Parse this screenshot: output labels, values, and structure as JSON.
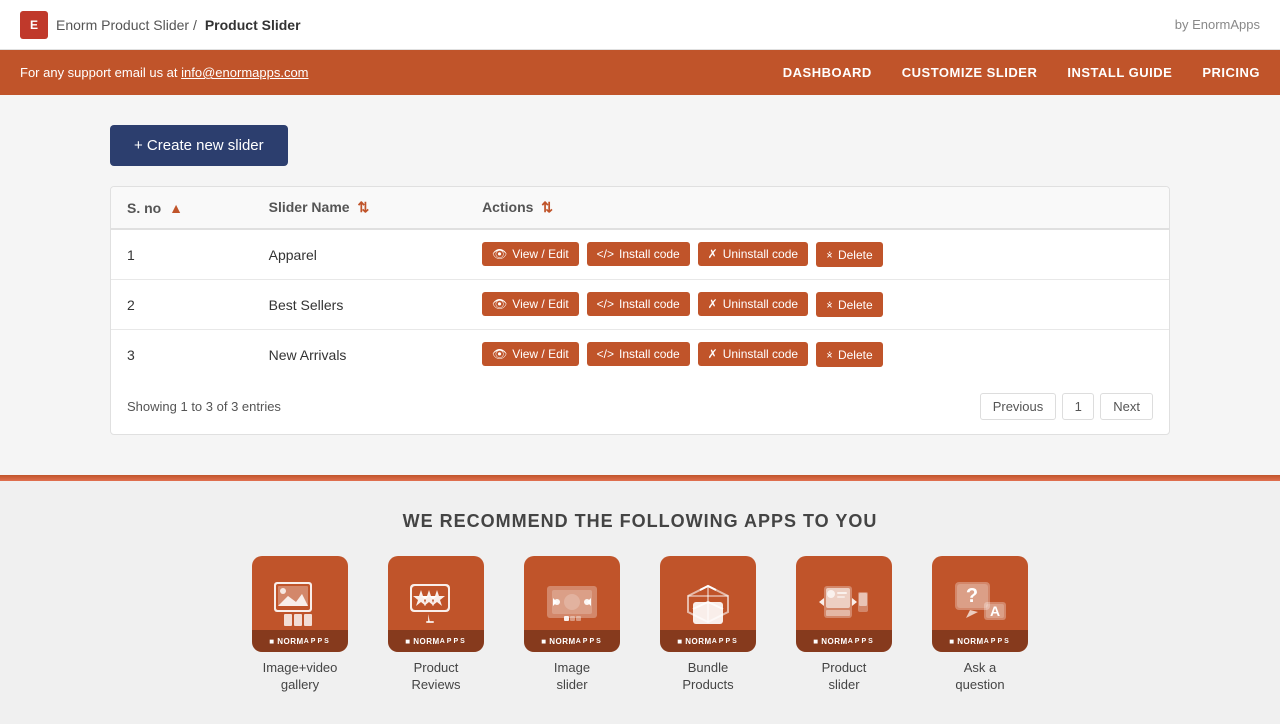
{
  "topbar": {
    "logo_text": "E",
    "breadcrumb_prefix": "Enorm Product Slider / ",
    "breadcrumb_current": "Product Slider",
    "by_label": "by EnormApps"
  },
  "navbar": {
    "support_text": "For any support email us at ",
    "support_email": "info@enormapps.com",
    "nav_links": [
      {
        "id": "dashboard",
        "label": "DASHBOARD"
      },
      {
        "id": "customize",
        "label": "CUSTOMIZE SLIDER"
      },
      {
        "id": "install",
        "label": "INSTALL GUIDE"
      },
      {
        "id": "pricing",
        "label": "PRICING"
      }
    ]
  },
  "create_button": "+ Create new slider",
  "table": {
    "columns": [
      {
        "id": "sno",
        "label": "S. no",
        "sortable": true
      },
      {
        "id": "slider_name",
        "label": "Slider Name",
        "sortable": true
      },
      {
        "id": "actions",
        "label": "Actions",
        "sortable": false
      }
    ],
    "rows": [
      {
        "sno": "1",
        "name": "Apparel"
      },
      {
        "sno": "2",
        "name": "Best Sellers"
      },
      {
        "sno": "3",
        "name": "New Arrivals"
      }
    ],
    "action_buttons": {
      "view_edit": "View / Edit",
      "install_code": "Install code",
      "uninstall_code": "Uninstall code",
      "delete": "Delete"
    }
  },
  "pagination": {
    "showing_text": "Showing 1 to 3 of 3 entries",
    "previous": "Previous",
    "current_page": "1",
    "next": "Next"
  },
  "recommendations": {
    "title": "WE RECOMMEND THE FOLLOWING APPS TO YOU",
    "apps": [
      {
        "id": "image-video-gallery",
        "label": "Image+video\ngallery",
        "icon": "gallery"
      },
      {
        "id": "product-reviews",
        "label": "Product\nReviews",
        "icon": "reviews"
      },
      {
        "id": "image-slider",
        "label": "Image\nslider",
        "icon": "slider"
      },
      {
        "id": "bundle-products",
        "label": "Bundle\nProducts",
        "icon": "bundle"
      },
      {
        "id": "product-slider",
        "label": "Product\nslider",
        "icon": "product-slider"
      },
      {
        "id": "ask-question",
        "label": "Ask a\nquestion",
        "icon": "question"
      }
    ]
  }
}
